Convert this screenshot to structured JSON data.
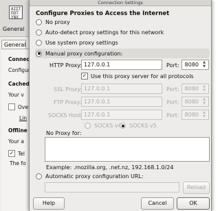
{
  "background_window": {
    "toolbar_item_label": "General",
    "icon_text": "ΑΙΣΤ ΠΟΤ ΥΝΧ",
    "tab_label": "General",
    "fragments": {
      "connect": "Connect",
      "configure": "Configure",
      "cached": "Cached",
      "your_v": "Your v",
      "ove": "Ove",
      "lin": "Lin",
      "offline": "Offline",
      "your_a": "Your a",
      "tel": "Tel",
      "the_fo": "The fo"
    }
  },
  "dialog": {
    "title": "Connection Settings",
    "heading": "Configure Proxies to Access the Internet",
    "options": {
      "no_proxy": "No proxy",
      "auto_detect": "Auto-detect proxy settings for this network",
      "system": "Use system proxy settings",
      "manual": "Manual proxy configuration:",
      "auto_url": "Automatic proxy configuration URL:"
    },
    "selected_option": "manual",
    "http": {
      "label": "HTTP Proxy:",
      "value": "127.0.0.1",
      "port_label": "Port:",
      "port": "8080"
    },
    "same_proxy_checkbox": {
      "label": "Use this proxy server for all protocols",
      "checked": true
    },
    "ssl": {
      "label": "SSL Proxy:",
      "value": "127.0.0.1",
      "port_label": "Port:",
      "port": "8080"
    },
    "ftp": {
      "label": "FTP Proxy:",
      "value": "127.0.0.1",
      "port_label": "Port:",
      "port": "8080"
    },
    "socks": {
      "label": "SOCKS Host:",
      "value": "127.0.0.1",
      "port_label": "Port:",
      "port": "8080"
    },
    "socks_versions": [
      "SOCKS v4",
      "SOCKS v5"
    ],
    "socks_selected": "SOCKS v5",
    "no_proxy_for": {
      "label": "No Proxy for:",
      "value": "",
      "example": "Example: .mozilla.org, .net.nz, 192.168.1.0/24"
    },
    "auto_url_value": "",
    "buttons": {
      "reload": "Reload",
      "help": "Help",
      "cancel": "Cancel",
      "ok": "OK"
    }
  }
}
